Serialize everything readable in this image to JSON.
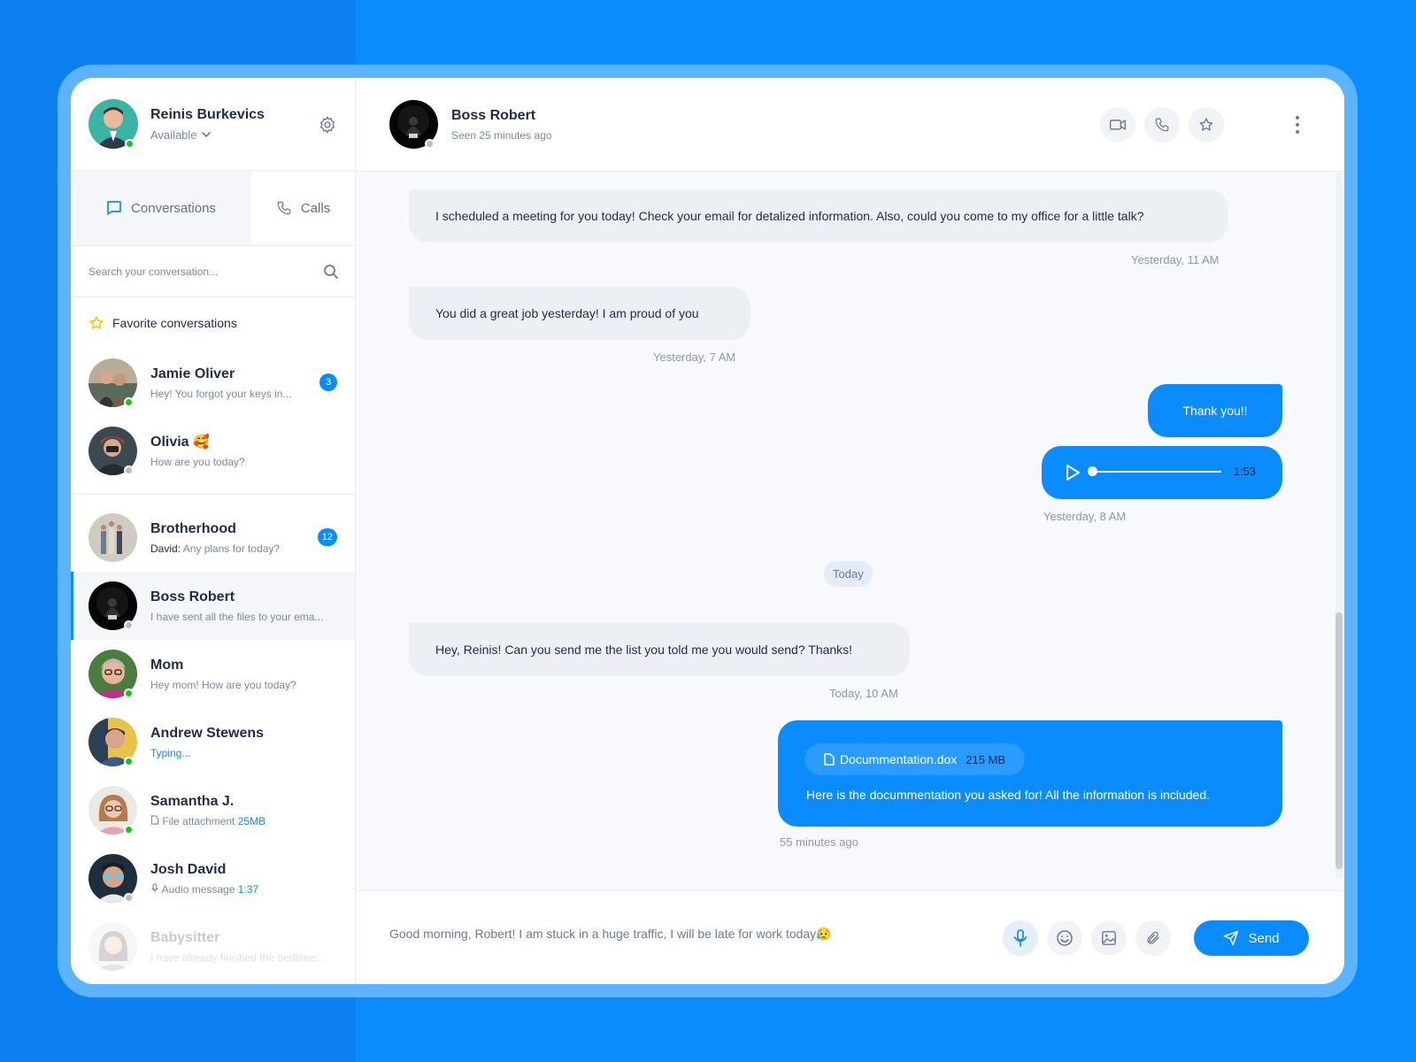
{
  "colors": {
    "accent": "#0a8cff",
    "online": "#1ec21e",
    "offline": "#b6bcc8",
    "favorite": "#ffc107"
  },
  "profile": {
    "name": "Reinis Burkevics",
    "status": "Available"
  },
  "tabs": {
    "conversations": "Conversations",
    "calls": "Calls"
  },
  "search": {
    "placeholder": "Search your conversation..."
  },
  "favorites_label": "Favorite conversations",
  "favorites": [
    {
      "name": "Jamie Oliver",
      "preview": "Hey! You forgot your keys in...",
      "badge": "3",
      "status": "online"
    },
    {
      "name": "Olivia",
      "emoji": "🥰",
      "preview": "How are you today?",
      "status": "offline"
    }
  ],
  "conversations": [
    {
      "name": "Brotherhood",
      "sender": "David:",
      "preview": " Any plans for today?",
      "badge": "12"
    },
    {
      "name": "Boss Robert",
      "preview": "I have sent all the files to your ema...",
      "status": "offline",
      "active": true
    },
    {
      "name": "Mom",
      "preview": "Hey mom! How are you today?",
      "status": "online"
    },
    {
      "name": "Andrew Stewens",
      "preview": "Typing...",
      "status": "online"
    },
    {
      "name": "Samantha J.",
      "preview": "File attachment",
      "extra": "25MB",
      "status": "online"
    },
    {
      "name": "Josh David",
      "preview": "Audio message",
      "extra": "1:37",
      "status": "offline"
    },
    {
      "name": "Babysitter",
      "preview": "I have already finished the bedtime..."
    }
  ],
  "chat": {
    "contact_name": "Boss Robert",
    "seen": "Seen 25 minutes ago",
    "messages": {
      "m1": "I scheduled a meeting for you today! Check your email for detalized information. Also, could you come to my office for a little talk?",
      "t1": "Yesterday, 11 AM",
      "m2": "You did a great job yesterday! I am proud of you",
      "t2": "Yesterday, 7 AM",
      "m3": "Thank you!!",
      "audio_duration": "1:53",
      "t3": "Yesterday, 8 AM",
      "day": "Today",
      "m4": "Hey, Reinis! Can you send me the list you told me you would send? Thanks!",
      "t4": "Today, 10 AM",
      "file_name": "Docummentation.dox",
      "file_size": "215 MB",
      "m5": "Here is the docummentation you asked for! All the information is included.",
      "t5": "55 minutes ago"
    },
    "audio_progress": 0.0,
    "composer_text": "Good morning, Robert! I am stuck in a huge traffic, I will be late for work today😥",
    "send_label": "Send"
  }
}
